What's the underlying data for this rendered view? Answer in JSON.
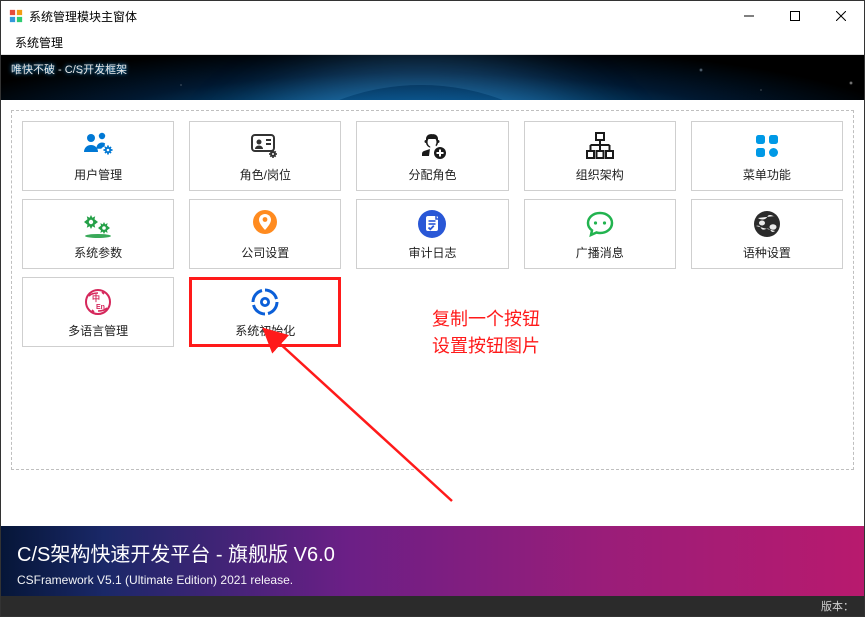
{
  "window": {
    "title": "系统管理模块主窗体"
  },
  "menu": {
    "system": "系统管理"
  },
  "banner": {
    "text": "唯快不破 - C/S开发框架"
  },
  "tiles": [
    {
      "id": "user-mgmt",
      "label": "用户管理",
      "icon": "users-gear",
      "color": "#0078d4"
    },
    {
      "id": "role-post",
      "label": "角色/岗位",
      "icon": "id-gear",
      "color": "#333333"
    },
    {
      "id": "assign-role",
      "label": "分配角色",
      "icon": "agent-plus",
      "color": "#1a1a1a"
    },
    {
      "id": "org-struct",
      "label": "组织架构",
      "icon": "org-chart",
      "color": "#1a1a1a"
    },
    {
      "id": "menu-func",
      "label": "菜单功能",
      "icon": "grid-tiles",
      "color": "#0099e6"
    },
    {
      "id": "sys-param",
      "label": "系统参数",
      "icon": "gears",
      "color": "#24a047"
    },
    {
      "id": "company",
      "label": "公司设置",
      "icon": "location-pin",
      "color": "#ff8b1f"
    },
    {
      "id": "audit-log",
      "label": "审计日志",
      "icon": "document-check",
      "color": "#2957d6"
    },
    {
      "id": "broadcast",
      "label": "广播消息",
      "icon": "chat-bubble",
      "color": "#22b34f"
    },
    {
      "id": "language",
      "label": "语种设置",
      "icon": "globe",
      "color": "#2b2b2b"
    },
    {
      "id": "multilang",
      "label": "多语言管理",
      "icon": "lang-zh-en",
      "color": "#d5275b"
    },
    {
      "id": "sys-init",
      "label": "系统初始化",
      "icon": "refresh-circle",
      "color": "#0b5fd8"
    }
  ],
  "annotation": {
    "line1": "复制一个按钮",
    "line2": "设置按钮图片"
  },
  "footer": {
    "title": "C/S架构快速开发平台 - 旗舰版 V6.0",
    "subtitle": "CSFramework V5.1 (Ultimate Edition) 2021 release."
  },
  "statusbar": {
    "version_label": "版本："
  }
}
